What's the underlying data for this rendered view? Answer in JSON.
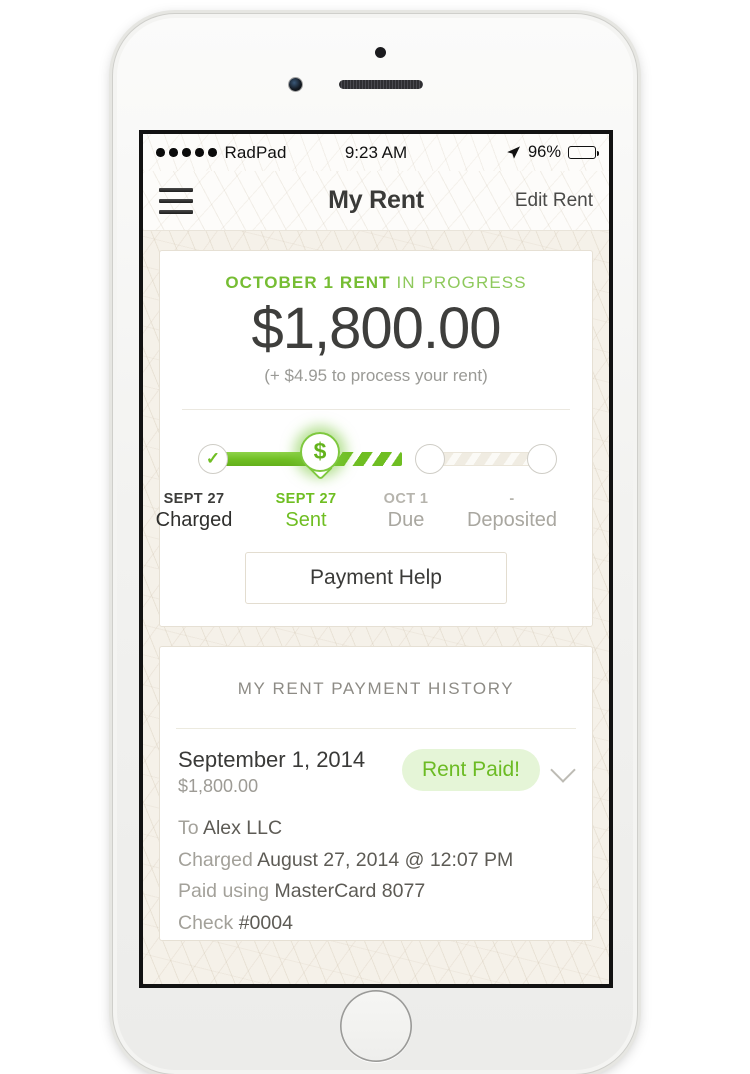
{
  "status_bar": {
    "signal_dots": 5,
    "carrier": "RadPad",
    "time": "9:23 AM",
    "location_icon": "location-arrow-icon",
    "battery_percent": "96%",
    "battery_level": 96
  },
  "nav_bar": {
    "menu_icon": "hamburger-menu-icon",
    "title": "My Rent",
    "action_label": "Edit Rent"
  },
  "rent_card": {
    "status_prefix": "OCTOBER 1 RENT",
    "status_suffix": "IN PROGRESS",
    "amount": "$1,800.00",
    "fee_note": "(+ $4.95 to process your rent)",
    "help_button_label": "Payment Help",
    "tracker": {
      "steps": [
        {
          "date": "SEPT 27",
          "name": "Charged",
          "state": "past",
          "icon": "check-icon"
        },
        {
          "date": "SEPT 27",
          "name": "Sent",
          "state": "current",
          "icon": "dollar-pin-icon"
        },
        {
          "date": "OCT 1",
          "name": "Due",
          "state": "future",
          "icon": "empty-circle-icon"
        },
        {
          "date": "-",
          "name": "Deposited",
          "state": "future",
          "icon": "empty-circle-icon"
        }
      ]
    }
  },
  "history": {
    "title": "MY RENT PAYMENT HISTORY",
    "entry": {
      "date": "September 1, 2014",
      "amount": "$1,800.00",
      "badge_label": "Rent Paid!",
      "expand_icon": "chevron-down-icon",
      "details": [
        {
          "label": "To",
          "value": "Alex LLC"
        },
        {
          "label": "Charged",
          "value": "August 27, 2014 @ 12:07 PM"
        },
        {
          "label": "Paid using",
          "value": "MasterCard 8077"
        },
        {
          "label": "Check",
          "value": "#0004"
        }
      ]
    }
  },
  "colors": {
    "green_accent": "#6fbe22",
    "green_light": "#8fd34a",
    "badge_bg": "#e5f5d7",
    "paper_bg": "#f5f1e9",
    "text_dark": "#3a3a38",
    "text_muted": "#a3a19a"
  }
}
